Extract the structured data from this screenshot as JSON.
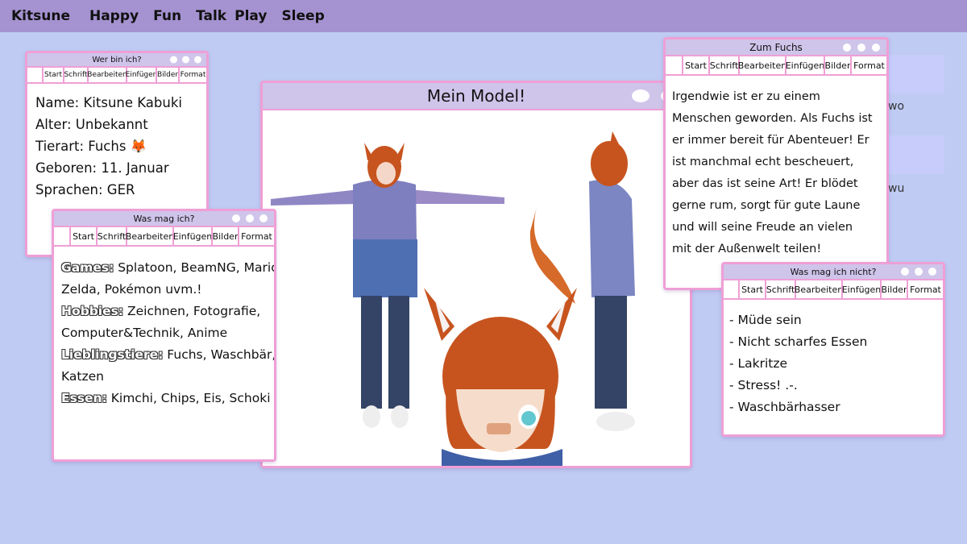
{
  "nav": {
    "brand": "Kitsune",
    "items": [
      "Happy",
      "Fun",
      "Talk",
      "Play",
      "Sleep"
    ]
  },
  "background": {
    "text1": "wo",
    "text2": "wu"
  },
  "toolbar_labels": [
    "Start",
    "Schrift",
    "Bearbeiten",
    "Einfügen",
    "Bilder",
    "Format"
  ],
  "windows": {
    "wer_bin_ich": {
      "title": "Wer bin ich?",
      "lines": [
        "Name: Kitsune Kabuki",
        "Alter: Unbekannt",
        "Tierart: Fuchs 🦊",
        "Geboren: 11. Januar",
        "Sprachen: GER"
      ]
    },
    "was_mag_ich": {
      "title": "Was mag ich?",
      "entries": [
        {
          "key": "Games:",
          "value": " Splatoon, BeamNG, Mario,"
        },
        {
          "key": "",
          "value": "Zelda, Pokémon uvm.!"
        },
        {
          "key": "Hobbies:",
          "value": " Zeichnen, Fotografie,"
        },
        {
          "key": "",
          "value": "Computer&Technik, Anime"
        },
        {
          "key": "Lieblingstiere:",
          "value": " Fuchs, Waschbär,"
        },
        {
          "key": "",
          "value": "Katzen"
        },
        {
          "key": "Essen:",
          "value": " Kimchi, Chips, Eis, Schoki"
        }
      ]
    },
    "model": {
      "title": "Mein Model!"
    },
    "zum_fuchs": {
      "title": "Zum Fuchs",
      "lines": [
        "Irgendwie ist er zu einem",
        "Menschen geworden. Als Fuchs ist",
        "er immer bereit für Abenteuer! Er",
        "ist manchmal echt bescheuert,",
        "aber das ist seine Art! Er blödet",
        "gerne rum, sorgt für gute Laune",
        "und will seine Freude an vielen",
        "mit der Außenwelt teilen!"
      ]
    },
    "mag_ich_nicht": {
      "title": "Was mag ich nicht?",
      "lines": [
        "- Müde sein",
        "- Nicht scharfes Essen",
        "- Lakritze",
        "- Stress! .-.",
        "- Waschbärhasser"
      ]
    }
  },
  "colors": {
    "background": "#bfcbf3",
    "topbar": "#a592d0",
    "window_border": "#ef9fd6",
    "titlebar": "#cfc4ea"
  }
}
